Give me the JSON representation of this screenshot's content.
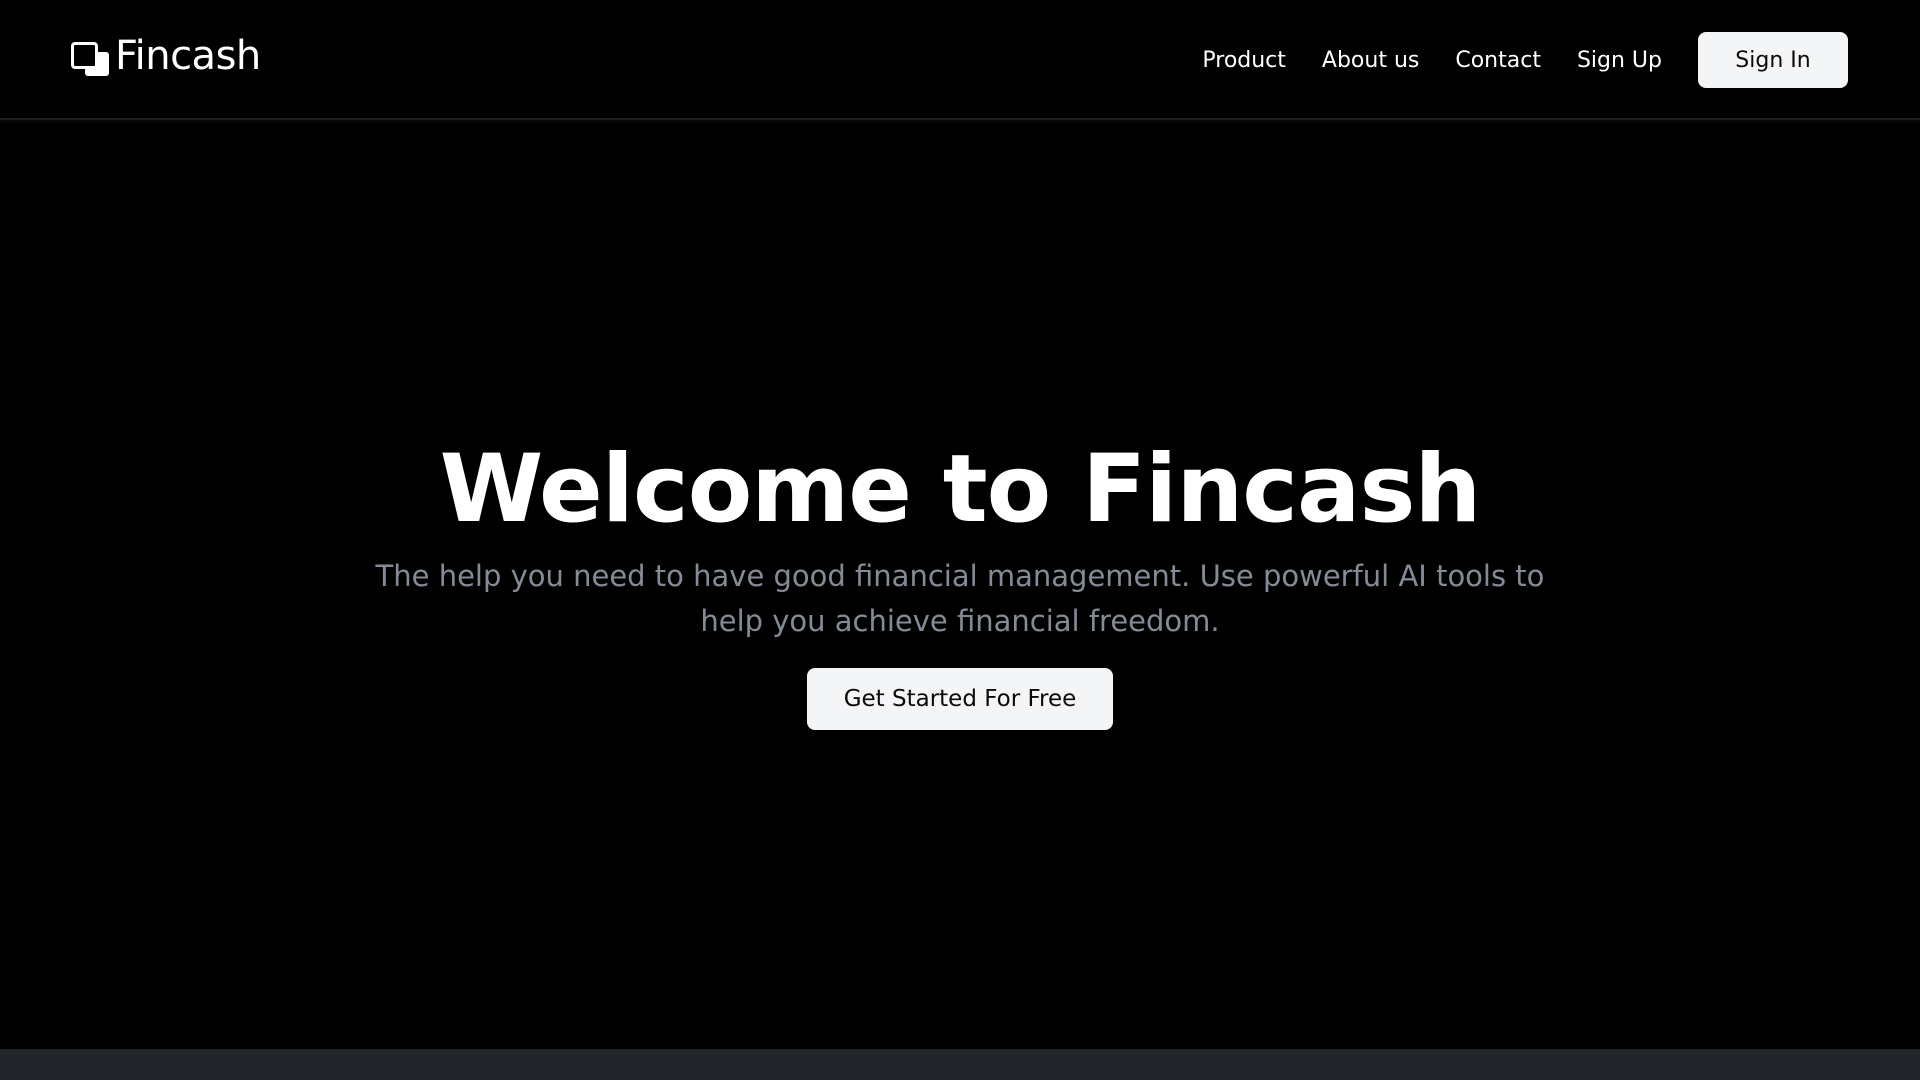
{
  "brand": {
    "name": "Fincash",
    "icon": "stacked-squares-logo-icon"
  },
  "nav": {
    "items": [
      {
        "label": "Product"
      },
      {
        "label": "About us"
      },
      {
        "label": "Contact"
      },
      {
        "label": "Sign Up"
      }
    ],
    "sign_in_label": "Sign In"
  },
  "hero": {
    "title": "Welcome to Fincash",
    "subtitle": "The help you need to have good financial management. Use powerful AI tools to help you achieve financial freedom.",
    "cta_label": "Get Started For Free"
  },
  "colors": {
    "background": "#000000",
    "text": "#ffffff",
    "muted_text": "#858b96",
    "button_bg": "#f4f5f7",
    "footer_strip": "#212428"
  }
}
